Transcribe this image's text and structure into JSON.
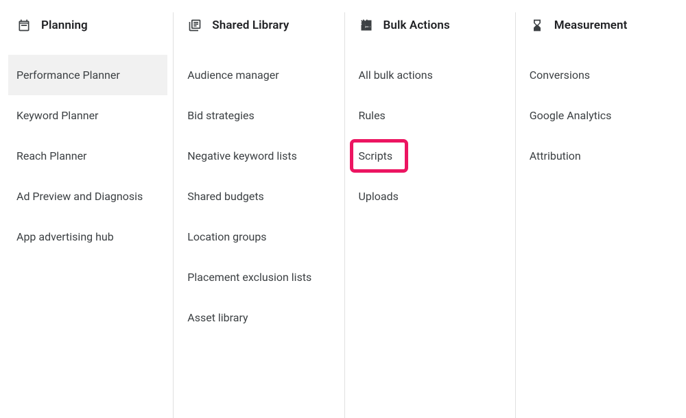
{
  "columns": [
    {
      "icon": "calendar-icon",
      "title": "Planning",
      "items": [
        {
          "label": "Performance Planner",
          "selected": true
        },
        {
          "label": "Keyword Planner"
        },
        {
          "label": "Reach Planner"
        },
        {
          "label": "Ad Preview and Diagnosis"
        },
        {
          "label": "App advertising hub"
        }
      ]
    },
    {
      "icon": "library-icon",
      "title": "Shared Library",
      "items": [
        {
          "label": "Audience manager"
        },
        {
          "label": "Bid strategies"
        },
        {
          "label": "Negative keyword lists"
        },
        {
          "label": "Shared budgets"
        },
        {
          "label": "Location groups"
        },
        {
          "label": "Placement exclusion lists"
        },
        {
          "label": "Asset library"
        }
      ]
    },
    {
      "icon": "bulk-icon",
      "title": "Bulk Actions",
      "items": [
        {
          "label": "All bulk actions"
        },
        {
          "label": "Rules"
        },
        {
          "label": "Scripts",
          "highlighted": true
        },
        {
          "label": "Uploads"
        }
      ]
    },
    {
      "icon": "hourglass-icon",
      "title": "Measurement",
      "items": [
        {
          "label": "Conversions"
        },
        {
          "label": "Google Analytics"
        },
        {
          "label": "Attribution"
        }
      ]
    }
  ]
}
